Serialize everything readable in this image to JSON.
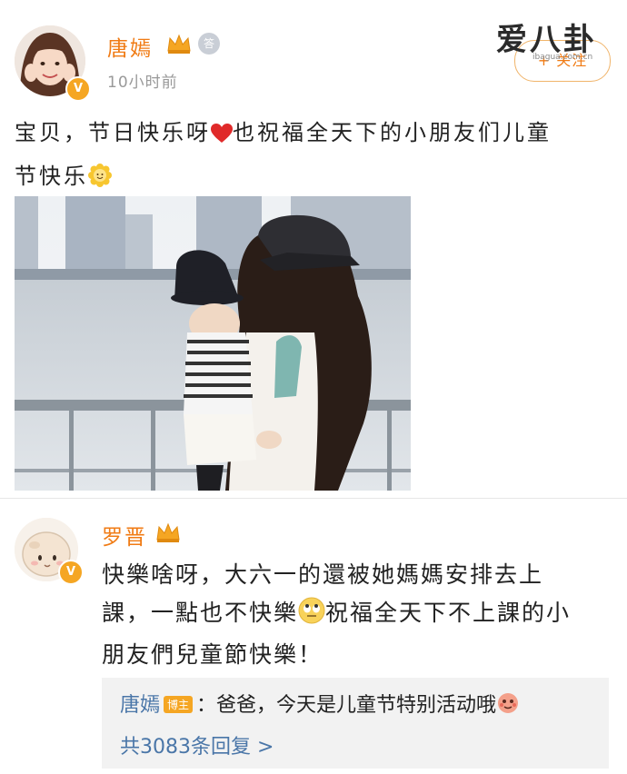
{
  "post": {
    "author_name": "唐嫣",
    "level_badge": "答",
    "time": "10小时前",
    "follow_button": "+ 关注",
    "watermark_logo": "爱八卦",
    "watermark_url": "ibagua.com.cn",
    "text_line1": "宝贝，节日快乐呀",
    "text_line1_b": "也祝福全天下的小朋友们儿童",
    "text_line2": "节快乐",
    "heart_icon": "heart-icon",
    "sun_icon": "smiling-sun-icon"
  },
  "comment": {
    "author_name": "罗晋",
    "text_line1": "快樂啥呀，大六一的還被她媽媽安排去上",
    "text_line2a": "課，一點也不快樂",
    "text_line2b": "祝福全天下不上課的小",
    "text_line3": "朋友們兒童節快樂！",
    "eyeroll_icon": "eye-roll-emoji-icon"
  },
  "reply": {
    "author_name": "唐嫣",
    "host_badge": "博主",
    "text": "：爸爸，今天是儿童节特别活动哦",
    "more": "共3083条回复 >"
  },
  "colors": {
    "accent": "#f07b14",
    "link": "#4a76a8",
    "vip_badge": "#f5a623"
  }
}
